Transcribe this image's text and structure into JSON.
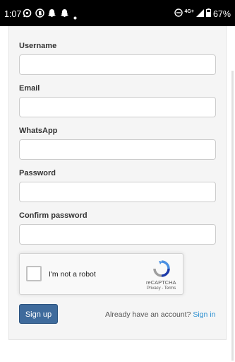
{
  "status_bar": {
    "time": "1:07",
    "network": "4G+",
    "battery": "67%"
  },
  "form": {
    "username_label": "Username",
    "username_value": "",
    "email_label": "Email",
    "email_value": "",
    "whatsapp_label": "WhatsApp",
    "whatsapp_value": "",
    "password_label": "Password",
    "password_value": "",
    "confirm_label": "Confirm password",
    "confirm_value": ""
  },
  "captcha": {
    "label": "I'm not a robot",
    "brand": "reCAPTCHA",
    "privacy": "Privacy",
    "sep": " - ",
    "terms": "Terms"
  },
  "actions": {
    "signup_label": "Sign up",
    "already_text": "Already have an account?",
    "signin_link": "Sign in"
  },
  "colors": {
    "primary_button": "#3f6b9c",
    "link": "#2a8fd1"
  }
}
